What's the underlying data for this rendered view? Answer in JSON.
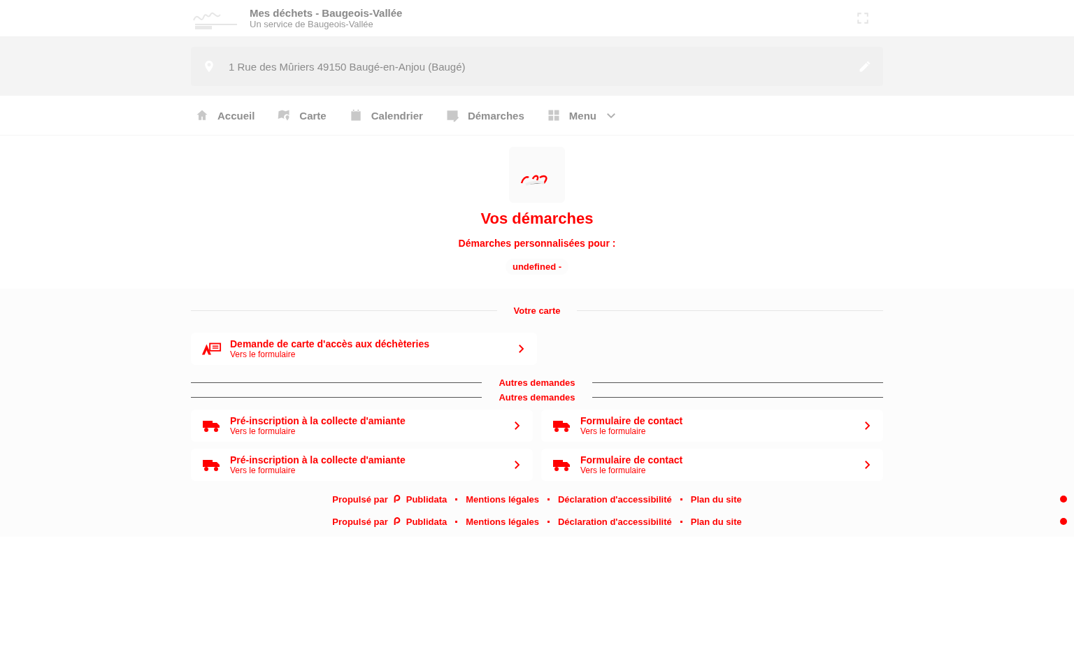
{
  "header": {
    "title": "Mes déchets - Baugeois-Vallée",
    "subtitle": "Un service de Baugeois-Vallée"
  },
  "address": {
    "text": "1 Rue des Mûriers 49150 Baugé-en-Anjou (Baugé)"
  },
  "nav": [
    {
      "label": "Accueil",
      "dropdown": false
    },
    {
      "label": "Carte",
      "dropdown": false
    },
    {
      "label": "Calendrier",
      "dropdown": false
    },
    {
      "label": "Démarches",
      "dropdown": false
    },
    {
      "label": "Menu",
      "dropdown": true
    }
  ],
  "hero": {
    "title": "Vos démarches",
    "subtitle": "Démarches personnalisées pour :",
    "user": "undefined -"
  },
  "sections": [
    {
      "heading": "Votre carte",
      "cards": [
        {
          "kind": "card",
          "title": "Demande de carte d'accès aux déchèteries",
          "subtitle": "Vers le formulaire"
        }
      ]
    },
    {
      "heading": "Autres demandes"
    },
    {
      "heading": "Autres demandes",
      "cards": [
        {
          "kind": "truck",
          "title": "Pré-inscription à la collecte d'amiante",
          "subtitle": "Vers le formulaire"
        },
        {
          "kind": "truck",
          "title": "Formulaire de contact",
          "subtitle": "Vers le formulaire"
        }
      ]
    },
    {
      "cards": [
        {
          "kind": "truck",
          "title": "Pré-inscription à la collecte d'amiante",
          "subtitle": "Vers le formulaire"
        },
        {
          "kind": "truck",
          "title": "Formulaire de contact",
          "subtitle": "Vers le formulaire"
        }
      ]
    }
  ],
  "footer": [
    {
      "powered": "Propulsé par",
      "brand": "Publidata",
      "links": [
        "Mentions légales",
        "Déclaration d'accessibilité",
        "Plan du site"
      ]
    },
    {
      "powered": "Propulsé par",
      "brand": "Publidata",
      "links": [
        "Mentions légales",
        "Déclaration d'accessibilité",
        "Plan du site"
      ]
    }
  ]
}
